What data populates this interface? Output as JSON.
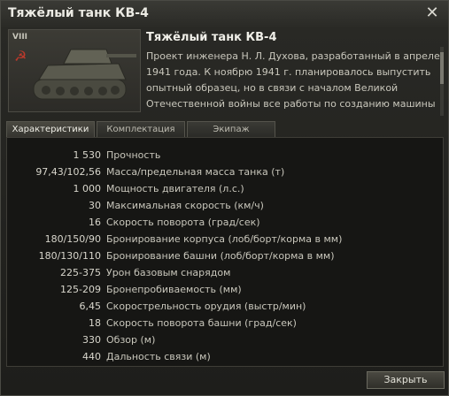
{
  "window": {
    "title": "Тяжёлый танк КВ-4",
    "close_icon": "close-icon"
  },
  "tank": {
    "tier": "VIII",
    "nation_icon": "hammer-sickle-icon",
    "name": "Тяжёлый танк КВ-4",
    "description": "Проект инженера Н. Л. Духова, разработанный в апреле 1941 года. К ноябрю 1941 г. планировалось выпустить опытный образец, но в связи с началом Великой Отечественной войны все работы по созданию машины"
  },
  "tabs": [
    {
      "label": "Характеристики",
      "active": true
    },
    {
      "label": "Комплектация",
      "active": false
    },
    {
      "label": "Экипаж",
      "active": false
    }
  ],
  "stats": [
    {
      "value": "1 530",
      "label": "Прочность"
    },
    {
      "value": "97,43/102,56",
      "label": "Масса/предельная масса танка (т)"
    },
    {
      "value": "1 000",
      "label": "Мощность двигателя (л.с.)"
    },
    {
      "value": "30",
      "label": "Максимальная скорость (км/ч)"
    },
    {
      "value": "16",
      "label": "Скорость поворота (град/сек)"
    },
    {
      "value": "180/150/90",
      "label": "Бронирование корпуса (лоб/борт/корма в мм)"
    },
    {
      "value": "180/130/110",
      "label": "Бронирование башни (лоб/борт/корма в мм)"
    },
    {
      "value": "225-375",
      "label": "Урон базовым снарядом"
    },
    {
      "value": "125-209",
      "label": "Бронепробиваемость (мм)"
    },
    {
      "value": "6,45",
      "label": "Скорострельность орудия (выстр/мин)"
    },
    {
      "value": "18",
      "label": "Скорость поворота башни (град/сек)"
    },
    {
      "value": "330",
      "label": "Обзор (м)"
    },
    {
      "value": "440",
      "label": "Дальность связи (м)"
    }
  ],
  "footer": {
    "close_label": "Закрыть"
  }
}
